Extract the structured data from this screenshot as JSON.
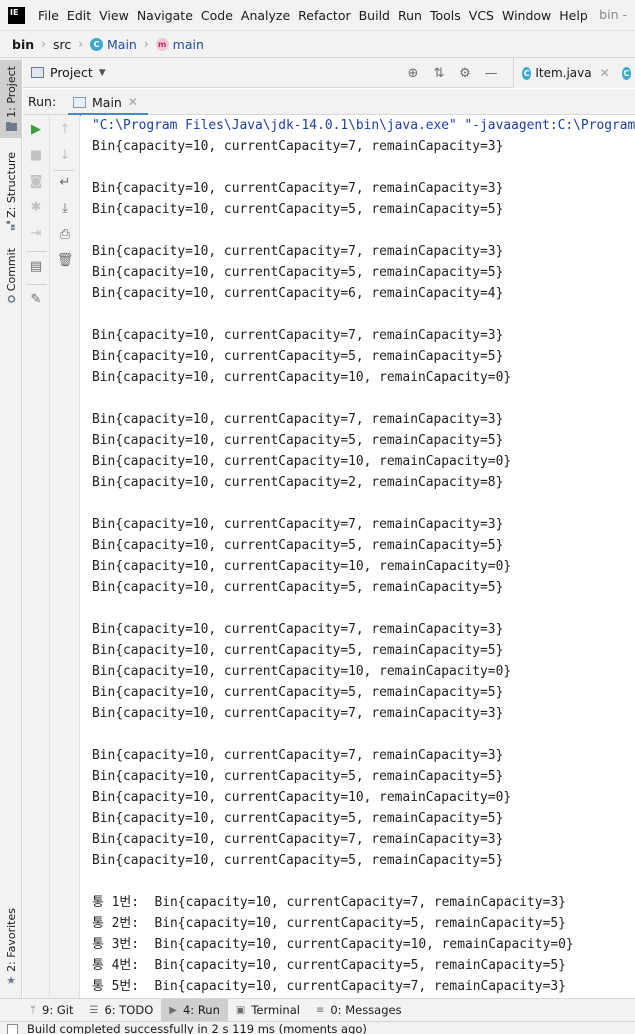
{
  "menubar": {
    "logo": "IE",
    "items": [
      "File",
      "Edit",
      "View",
      "Navigate",
      "Code",
      "Analyze",
      "Refactor",
      "Build",
      "Run",
      "Tools",
      "VCS",
      "Window",
      "Help"
    ],
    "window_title": "bin -"
  },
  "breadcrumb": {
    "project": "bin",
    "folder": "src",
    "class_name": "Main",
    "method_name": "main"
  },
  "left_strip": {
    "project_tab": "1: Project",
    "structure_tab": "Z: Structure",
    "commit_tab": "Commit",
    "favorites_tab": "2: Favorites"
  },
  "project_panel": {
    "label": "Project",
    "editor_tab_label": "Item.java"
  },
  "run_panel": {
    "title": "Run:",
    "tab_label": "Main"
  },
  "console": {
    "lines": [
      "\"C:\\Program Files\\Java\\jdk-14.0.1\\bin\\java.exe\" \"-javaagent:C:\\Program Files\\JetBrains",
      "Bin{capacity=10, currentCapacity=7, remainCapacity=3}",
      "",
      "Bin{capacity=10, currentCapacity=7, remainCapacity=3}",
      "Bin{capacity=10, currentCapacity=5, remainCapacity=5}",
      "",
      "Bin{capacity=10, currentCapacity=7, remainCapacity=3}",
      "Bin{capacity=10, currentCapacity=5, remainCapacity=5}",
      "Bin{capacity=10, currentCapacity=6, remainCapacity=4}",
      "",
      "Bin{capacity=10, currentCapacity=7, remainCapacity=3}",
      "Bin{capacity=10, currentCapacity=5, remainCapacity=5}",
      "Bin{capacity=10, currentCapacity=10, remainCapacity=0}",
      "",
      "Bin{capacity=10, currentCapacity=7, remainCapacity=3}",
      "Bin{capacity=10, currentCapacity=5, remainCapacity=5}",
      "Bin{capacity=10, currentCapacity=10, remainCapacity=0}",
      "Bin{capacity=10, currentCapacity=2, remainCapacity=8}",
      "",
      "Bin{capacity=10, currentCapacity=7, remainCapacity=3}",
      "Bin{capacity=10, currentCapacity=5, remainCapacity=5}",
      "Bin{capacity=10, currentCapacity=10, remainCapacity=0}",
      "Bin{capacity=10, currentCapacity=5, remainCapacity=5}",
      "",
      "Bin{capacity=10, currentCapacity=7, remainCapacity=3}",
      "Bin{capacity=10, currentCapacity=5, remainCapacity=5}",
      "Bin{capacity=10, currentCapacity=10, remainCapacity=0}",
      "Bin{capacity=10, currentCapacity=5, remainCapacity=5}",
      "Bin{capacity=10, currentCapacity=7, remainCapacity=3}",
      "",
      "Bin{capacity=10, currentCapacity=7, remainCapacity=3}",
      "Bin{capacity=10, currentCapacity=5, remainCapacity=5}",
      "Bin{capacity=10, currentCapacity=10, remainCapacity=0}",
      "Bin{capacity=10, currentCapacity=5, remainCapacity=5}",
      "Bin{capacity=10, currentCapacity=7, remainCapacity=3}",
      "Bin{capacity=10, currentCapacity=5, remainCapacity=5}",
      "",
      "통 1번:  Bin{capacity=10, currentCapacity=7, remainCapacity=3}",
      "통 2번:  Bin{capacity=10, currentCapacity=5, remainCapacity=5}",
      "통 3번:  Bin{capacity=10, currentCapacity=10, remainCapacity=0}",
      "통 4번:  Bin{capacity=10, currentCapacity=5, remainCapacity=5}",
      "통 5번:  Bin{capacity=10, currentCapacity=7, remainCapacity=3}"
    ]
  },
  "bottom_tabs": [
    "9: Git",
    "6: TODO",
    "4: Run",
    "Terminal",
    "0: Messages"
  ],
  "status": {
    "text": "Build completed successfully in 2 s 119 ms (moments ago)"
  },
  "colors": {
    "accent": "#4a88c7",
    "run_green": "#3d9b3d",
    "command_text": "#1f3ca8"
  }
}
